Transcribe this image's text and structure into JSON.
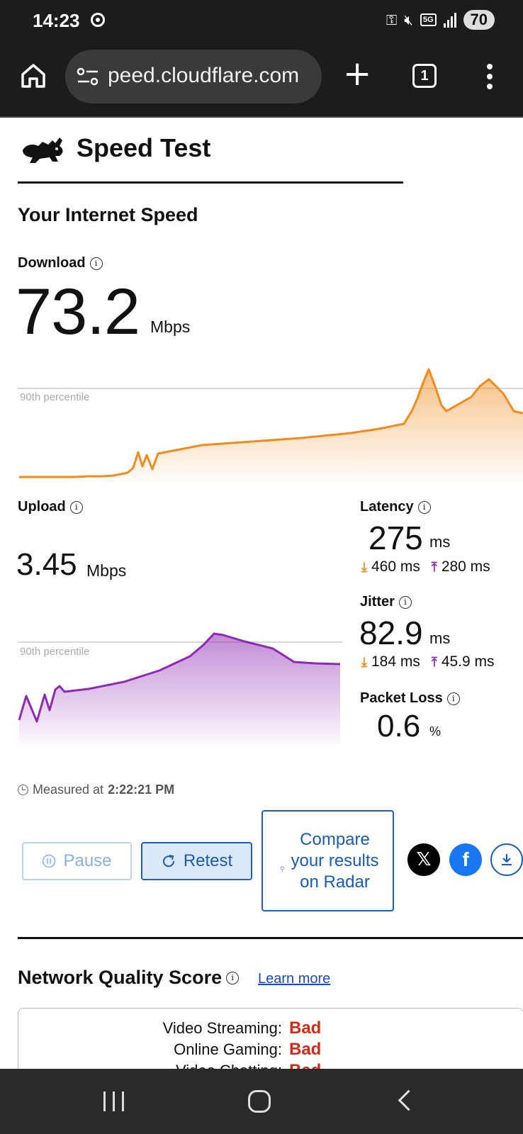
{
  "status_bar": {
    "time": "14:23",
    "network": "5G",
    "battery": "70"
  },
  "browser": {
    "url": "peed.cloudflare.com",
    "tab_count": "1"
  },
  "header": {
    "title": "Speed Test"
  },
  "section_title": "Your Internet Speed",
  "download": {
    "label": "Download",
    "value": "73.2",
    "unit": "Mbps",
    "percentile_label": "90th percentile",
    "color": "#f28b1d"
  },
  "upload": {
    "label": "Upload",
    "value": "3.45",
    "unit": "Mbps",
    "percentile_label": "90th percentile",
    "color": "#8e2bb3"
  },
  "latency": {
    "label": "Latency",
    "value": "275",
    "unit": "ms",
    "down_value": "460 ms",
    "up_value": "280 ms"
  },
  "jitter": {
    "label": "Jitter",
    "value": "82.9",
    "unit": "ms",
    "down_value": "184 ms",
    "up_value": "45.9 ms"
  },
  "packet_loss": {
    "label": "Packet Loss",
    "value": "0.6",
    "unit": "%"
  },
  "measured": {
    "prefix": "Measured at",
    "time": "2:22:21 PM"
  },
  "buttons": {
    "pause": "Pause",
    "retest": "Retest",
    "compare": "Compare your results on Radar"
  },
  "network_quality": {
    "title": "Network Quality Score",
    "learn_more": "Learn more",
    "rows": [
      {
        "label": "Video Streaming:",
        "value": "Bad"
      },
      {
        "label": "Online Gaming:",
        "value": "Bad"
      },
      {
        "label": "Video Chatting:",
        "value": "Bad"
      }
    ],
    "bad_color": "#d12a1a"
  },
  "icons": [
    "home-icon",
    "tune-icon",
    "plus-icon",
    "tabs-icon",
    "more-vert-icon",
    "rabbit-logo",
    "info-icon",
    "clock-icon",
    "pause-icon",
    "refresh-icon",
    "x-icon",
    "facebook-icon",
    "download-icon"
  ]
}
